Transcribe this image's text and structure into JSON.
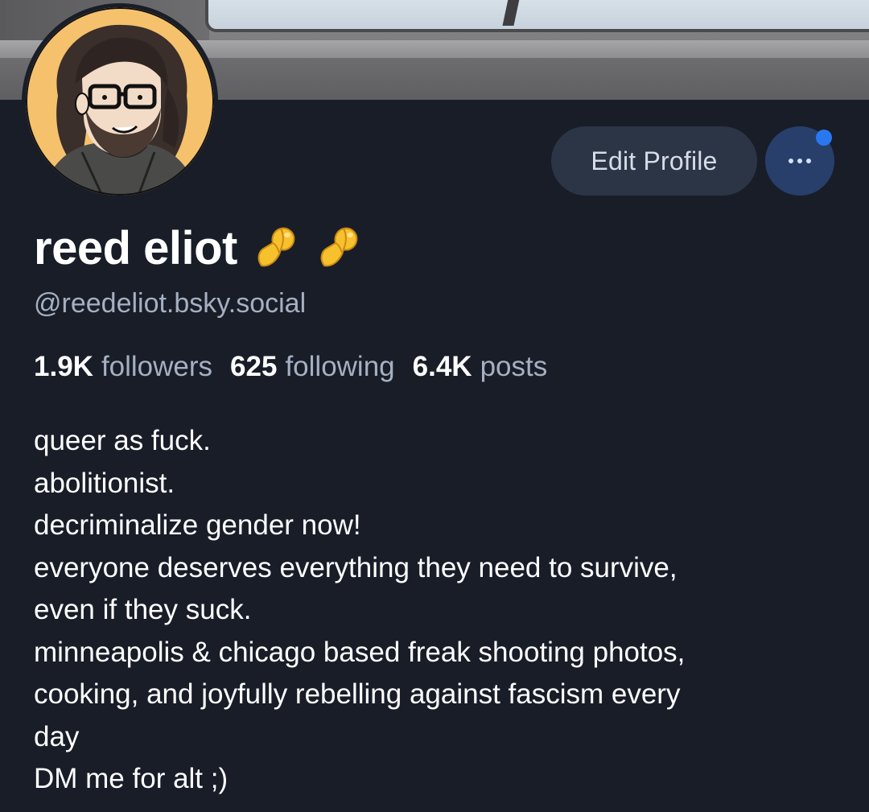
{
  "profile": {
    "display_name": "reed eliot",
    "handle": "@reedeliot.bsky.social",
    "name_emojis": [
      "pinching-hand-emoji",
      "pinching-hand-emoji"
    ]
  },
  "actions": {
    "edit_profile_label": "Edit Profile",
    "more_icon": "ellipsis-icon",
    "notification_dot": true
  },
  "stats": {
    "followers_count": "1.9K",
    "followers_label": "followers",
    "following_count": "625",
    "following_label": "following",
    "posts_count": "6.4K",
    "posts_label": "posts"
  },
  "bio": {
    "lines": [
      "queer as fuck.",
      "abolitionist.",
      "decriminalize gender now!",
      "everyone deserves everything they need to survive,",
      "even if they suck.",
      "minneapolis & chicago based freak shooting photos,",
      "cooking, and joyfully rebelling against fascism every",
      "day",
      "DM me for alt ;)"
    ]
  },
  "colors": {
    "background": "#181d28",
    "edit_button_bg": "#2c3546",
    "more_button_bg": "#283f6c",
    "accent_blue": "#2a78f0",
    "secondary_text": "#a6b0c2",
    "avatar_bg": "#f5c16c"
  }
}
